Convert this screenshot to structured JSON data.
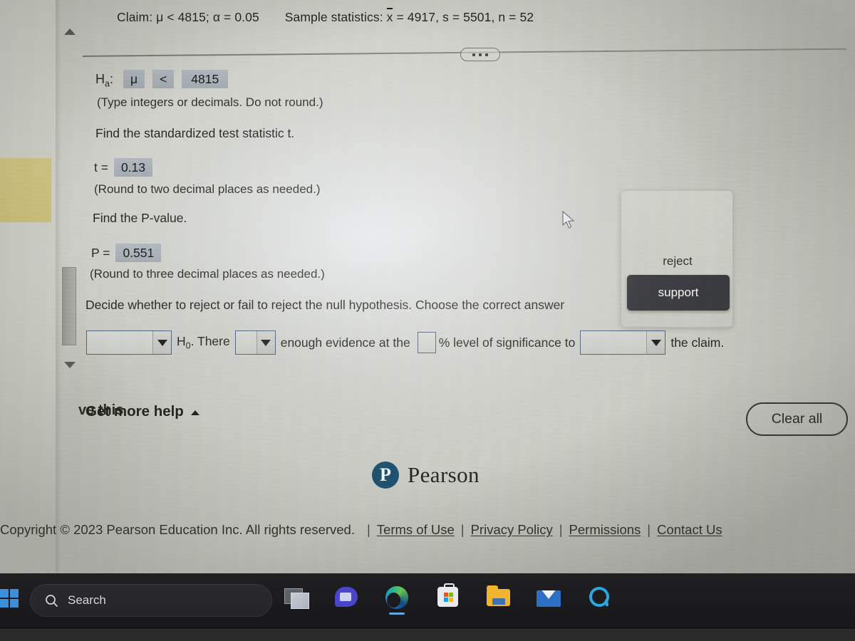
{
  "problem": {
    "claim_prefix": "Claim:",
    "claim_mu": "μ < 4815;",
    "claim_alpha": "α = 0.05",
    "sample_label": "Sample statistics:",
    "sample_xbar_sym": "x",
    "sample_xbar_val": " = 4917,",
    "sample_s": "s = 5501,",
    "sample_n": "n = 52"
  },
  "work": {
    "ha_label": "H",
    "ha_sub": "a",
    "ha_colon": ":",
    "ha_param": "μ",
    "ha_operator": "<",
    "ha_value": "4815",
    "note_integers": "(Type integers or decimals. Do not round.)",
    "find_t": "Find the standardized test statistic t.",
    "t_label": "t =",
    "t_value": "0.13",
    "note_two_decimals": "(Round to two decimal places as needed.)",
    "find_p": "Find the P-value.",
    "p_label": "P =",
    "p_value": "0.551",
    "note_three_decimals": "(Round to three decimal places as needed.)",
    "decide_text": "Decide whether to reject or fail to reject the null hypothesis. Choose the correct answer"
  },
  "answer_row": {
    "select1_value": "",
    "h0_label": "H",
    "h0_sub": "0",
    "text_there": ". There",
    "select2_value": "",
    "text_enough": "enough evidence at the",
    "alpha_input_value": "",
    "text_level": "% level of significance to",
    "select3_value": "",
    "text_claim": "the claim."
  },
  "dropdown": {
    "options": [
      {
        "label": "reject",
        "selected": false
      },
      {
        "label": "support",
        "selected": true
      }
    ]
  },
  "actions": {
    "save_this": "ve this",
    "get_more_help": "Get more help",
    "clear_all": "Clear all"
  },
  "brand": {
    "mark_letter": "P",
    "word": "Pearson"
  },
  "footer": {
    "copyright": "Copyright © 2023 Pearson Education Inc. All rights reserved.",
    "links": [
      "Terms of Use",
      "Privacy Policy",
      "Permissions",
      "Contact Us"
    ],
    "separator": "|"
  },
  "taskbar": {
    "search_placeholder": "Search",
    "icons": [
      "task-view-icon",
      "chat-icon",
      "edge-icon",
      "microsoft-store-icon",
      "file-explorer-icon",
      "mail-icon",
      "cortana-icon"
    ]
  },
  "colors": {
    "page_bg": "#c3c4bc",
    "answer_box": "#a9b0b6",
    "select_border": "#4d5a74",
    "highlight_bg": "#35363a",
    "pearson_blue": "#1d4b66",
    "taskbar_bg": "#1b1a1d"
  }
}
